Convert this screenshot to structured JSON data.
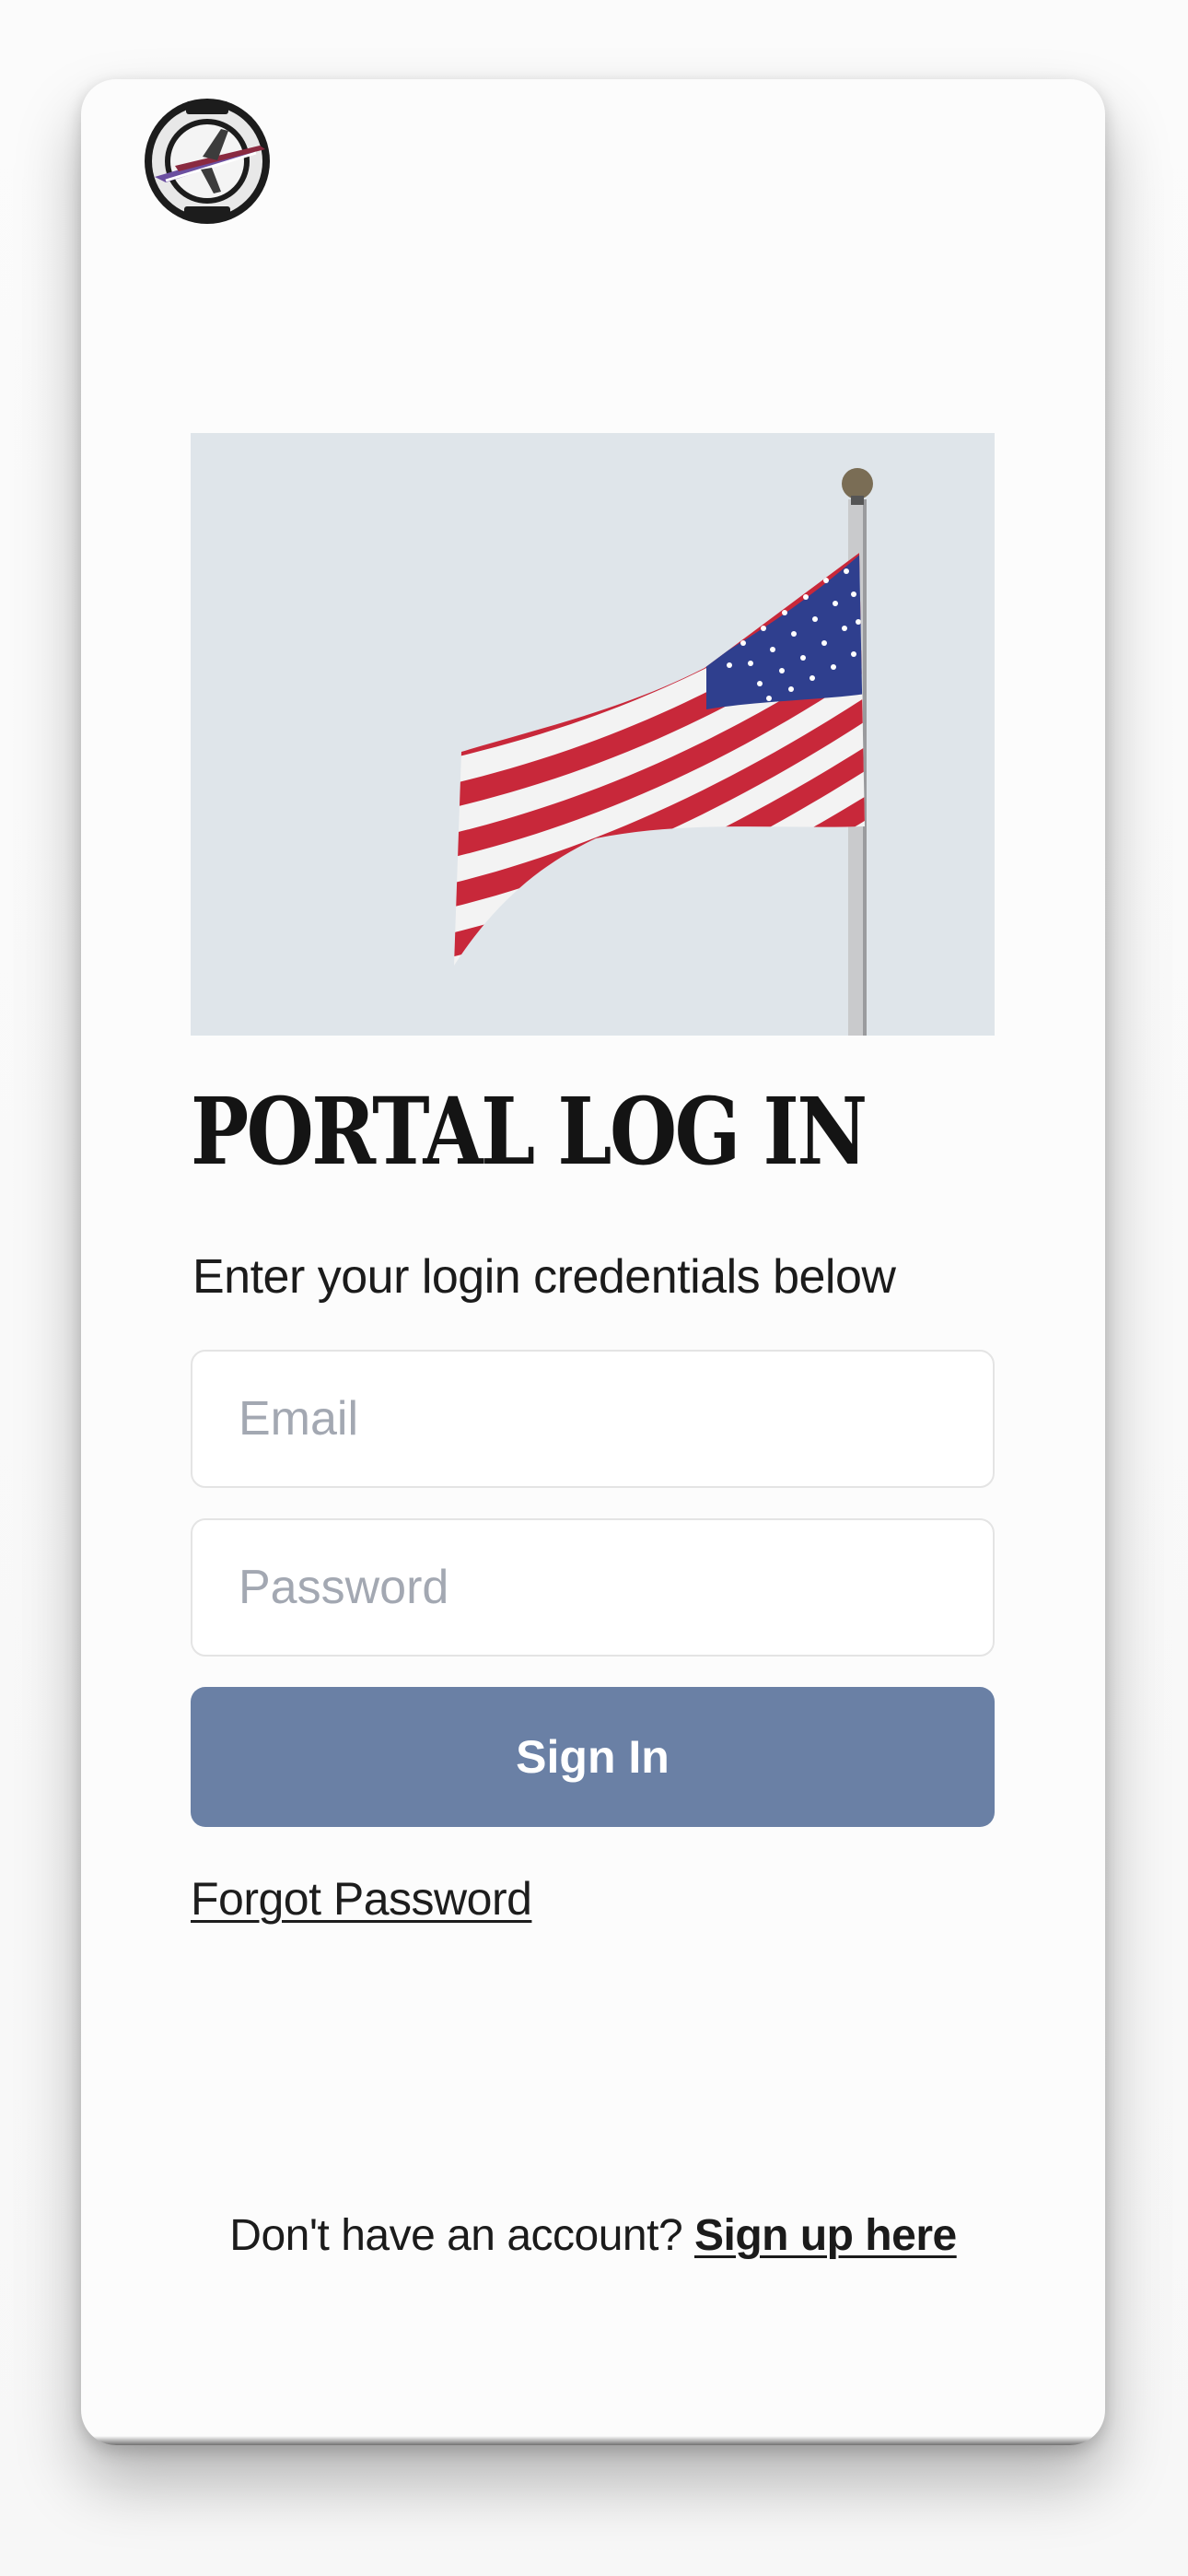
{
  "logo": {
    "icon": "airplane-emblem-icon"
  },
  "hero": {
    "icon": "american-flag-image"
  },
  "login": {
    "title": "PORTAL LOG IN",
    "subtitle": "Enter your login credentials below",
    "email_placeholder": "Email",
    "password_placeholder": "Password",
    "sign_in_label": "Sign In",
    "forgot_password_label": "Forgot Password"
  },
  "footer": {
    "prompt": "Don't have an account?",
    "signup_label": "Sign up here"
  },
  "colors": {
    "button": "#6a80a5",
    "flag_red": "#c8283a",
    "flag_blue": "#2f3f8e",
    "sky": "#dfe5ea"
  }
}
